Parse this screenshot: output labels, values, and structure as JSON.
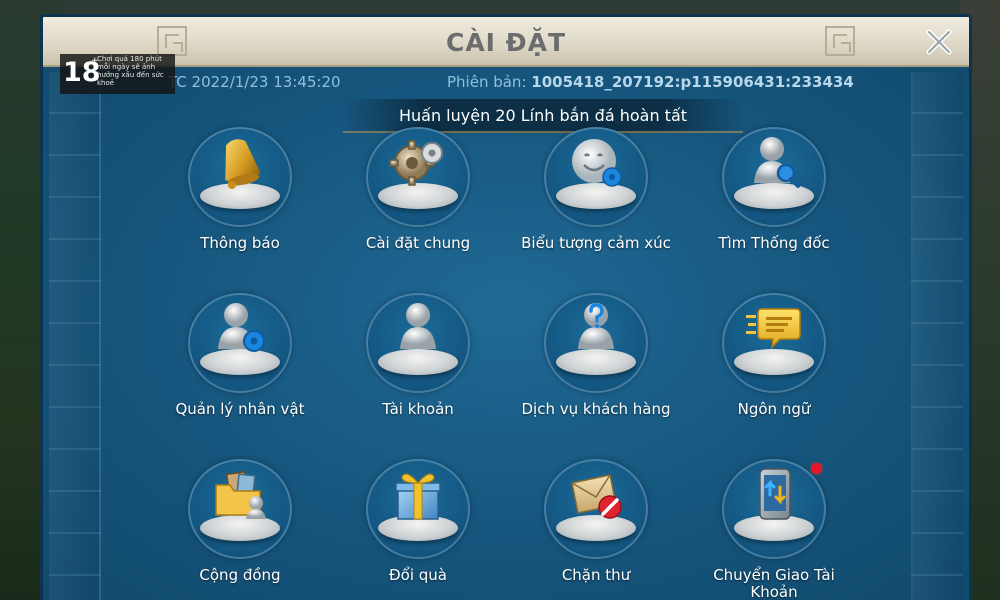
{
  "title": "CÀI ĐẶT",
  "utc_time": "TC 2022/1/23 13:45:20",
  "version_label": "Phiên bản:",
  "version_value": "1005418_207192:p115906431:233434",
  "notice": "Huấn luyện 20 Lính bắn đá hoàn tất",
  "age_rating": {
    "number": "18",
    "plus": "+",
    "warning": "Chơi quá 180 phút mỗi ngày sẽ ảnh hưởng xấu đến sức khoẻ"
  },
  "menu_items": [
    {
      "label": "Thông báo",
      "icon": "bell-icon"
    },
    {
      "label": "Cài đặt chung",
      "icon": "gears-icon"
    },
    {
      "label": "Biểu tượng cảm xúc",
      "icon": "emoji-icon"
    },
    {
      "label": "Tìm Thống đốc",
      "icon": "search-governor-icon"
    },
    {
      "label": "Quản lý nhân vật",
      "icon": "character-manage-icon"
    },
    {
      "label": "Tài khoản",
      "icon": "account-icon"
    },
    {
      "label": "Dịch vụ khách hàng",
      "icon": "customer-service-icon"
    },
    {
      "label": "Ngôn ngữ",
      "icon": "language-icon"
    },
    {
      "label": "Cộng đồng",
      "icon": "community-icon"
    },
    {
      "label": "Đổi quà",
      "icon": "gift-icon"
    },
    {
      "label": "Chặn thư",
      "icon": "block-mail-icon"
    },
    {
      "label": "Chuyển Giao Tài Khoản",
      "icon": "account-transfer-icon"
    }
  ],
  "colors": {
    "panel": "#16557d",
    "title_bar": "#ddd7c5",
    "notification_dot": "#e5182a"
  }
}
